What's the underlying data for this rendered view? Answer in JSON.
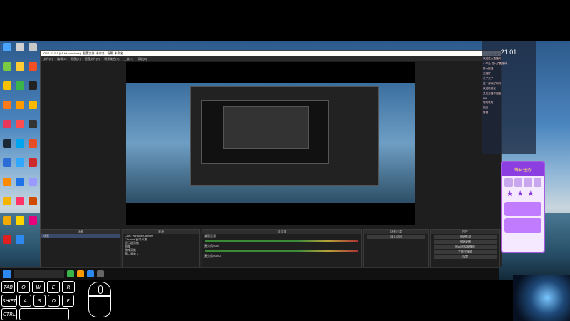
{
  "obs_window": {
    "title": "OBS 27.0.1 (64-bit, windows) - 配置文件: 未命名 - 场景: 未命名",
    "menu": [
      "文件(F)",
      "编辑(E)",
      "视图(V)",
      "配置文件(P)",
      "场景集合(S)",
      "工具(T)",
      "帮助(H)"
    ],
    "docks": {
      "scenes": {
        "header": "场景",
        "items": [
          "场景"
        ]
      },
      "sources": {
        "header": "来源",
        "items": [
          "Cam: Window Capture",
          "Chrome 窗口采集",
          "显示器采集",
          "图像",
          "游戏采集",
          "窗口采集 2"
        ]
      },
      "mixer": {
        "header": "混音器",
        "channels": [
          "桌面音频",
          "麦克风/Aux",
          "麦克风/Aux 2"
        ]
      },
      "transitions": {
        "header": "场景过渡",
        "value": "淡入淡出"
      },
      "controls": {
        "header": "控件",
        "buttons": [
          "开始推流",
          "开始录制",
          "启动虚拟摄像机",
          "工作室模式",
          "设置",
          "退出"
        ]
      }
    }
  },
  "chat_panel": {
    "time": "21:01",
    "lines": [
      "欢迎进入直播间",
      "小甲鱼 进入了直播间",
      "新人报道",
      "主播好",
      "来了来了",
      "这个游戏好玩吗",
      "欢迎新朋友",
      "关注主播不迷路",
      "666",
      "哈哈哈哈",
      "加油",
      "好看"
    ]
  },
  "widget": {
    "title": "每日任务"
  },
  "keyboard": {
    "rows": [
      [
        "TAB",
        "Q",
        "W",
        "E",
        "R"
      ],
      [
        "SHIFT",
        "A",
        "S",
        "D",
        "F"
      ],
      [
        "CTRL",
        ""
      ]
    ]
  }
}
